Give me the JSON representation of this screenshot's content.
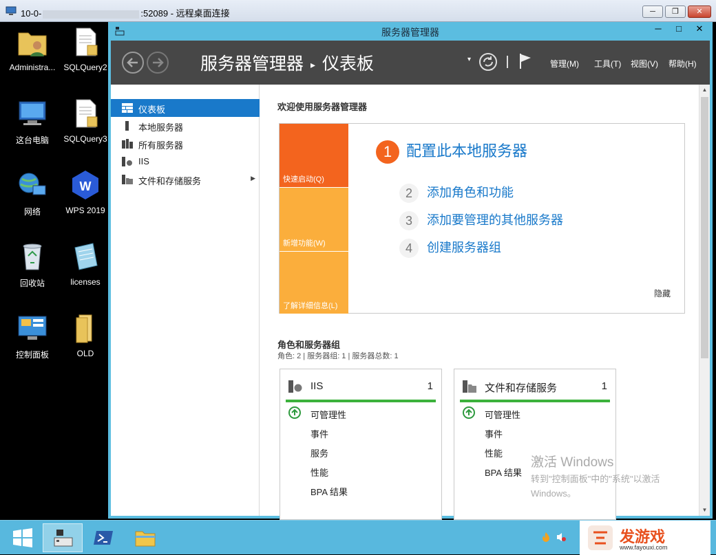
{
  "rdp": {
    "title_prefix": "10-0-",
    "title_suffix": ":52089 - 远程桌面连接",
    "controls": {
      "minimize": "─",
      "restore": "❐",
      "close": "✕"
    }
  },
  "desktop": {
    "icons": [
      {
        "label": "Administra...",
        "icon": "user-folder-icon"
      },
      {
        "label": "SQLQuery2",
        "icon": "sql-file-icon"
      },
      {
        "label": "这台电脑",
        "icon": "computer-icon"
      },
      {
        "label": "SQLQuery3",
        "icon": "sql-file-icon"
      },
      {
        "label": "网络",
        "icon": "network-icon"
      },
      {
        "label": "WPS 2019",
        "icon": "wps-icon"
      },
      {
        "label": "回收站",
        "icon": "recycle-bin-icon"
      },
      {
        "label": "licenses",
        "icon": "notepad-icon"
      },
      {
        "label": "控制面板",
        "icon": "control-panel-icon"
      },
      {
        "label": "OLD",
        "icon": "folder-icon"
      }
    ]
  },
  "sm": {
    "title": "服务器管理器",
    "controls": {
      "minimize": "─",
      "maximize": "□",
      "close": "✕"
    },
    "breadcrumb": {
      "root": "服务器管理器",
      "sep": "▸",
      "page": "仪表板"
    },
    "menu": {
      "manage": "管理(M)",
      "tools": "工具(T)",
      "view": "视图(V)",
      "help": "帮助(H)"
    },
    "dropdown": "▾",
    "nav": [
      {
        "label": "仪表板",
        "active": true
      },
      {
        "label": "本地服务器"
      },
      {
        "label": "所有服务器"
      },
      {
        "label": "IIS"
      },
      {
        "label": "文件和存储服务",
        "arrow": "▶"
      }
    ],
    "welcome": "欢迎使用服务器管理器",
    "tiles": {
      "quick": "快速启动(Q)",
      "new": "新增功能(W)",
      "learn": "了解详细信息(L)"
    },
    "steps": [
      {
        "num": "1",
        "label": "配置此本地服务器"
      },
      {
        "num": "2",
        "label": "添加角色和功能"
      },
      {
        "num": "3",
        "label": "添加要管理的其他服务器"
      },
      {
        "num": "4",
        "label": "创建服务器组"
      }
    ],
    "hide": "隐藏",
    "roles": {
      "title": "角色和服务器组",
      "summary": "角色: 2 | 服务器组: 1 | 服务器总数: 1",
      "cards": [
        {
          "name": "IIS",
          "count": "1",
          "rows": [
            "可管理性",
            "事件",
            "服务",
            "性能",
            "BPA 结果"
          ]
        },
        {
          "name": "文件和存储服务",
          "count": "1",
          "rows": [
            "可管理性",
            "事件",
            "性能",
            "BPA 结果"
          ]
        }
      ]
    },
    "activation": {
      "line1": "激活 Windows",
      "line2": "转到\"控制面板\"中的\"系统\"以激活",
      "line3": "Windows。"
    }
  },
  "watermark": {
    "brand": "发游戏",
    "url": "www.fayouxi.com"
  },
  "colors": {
    "accent": "#1979ca",
    "titlebar": "#5bbde0",
    "header": "#474747",
    "orange": "#f3641e",
    "amber": "#fbae3c",
    "green": "#3cb23c"
  }
}
